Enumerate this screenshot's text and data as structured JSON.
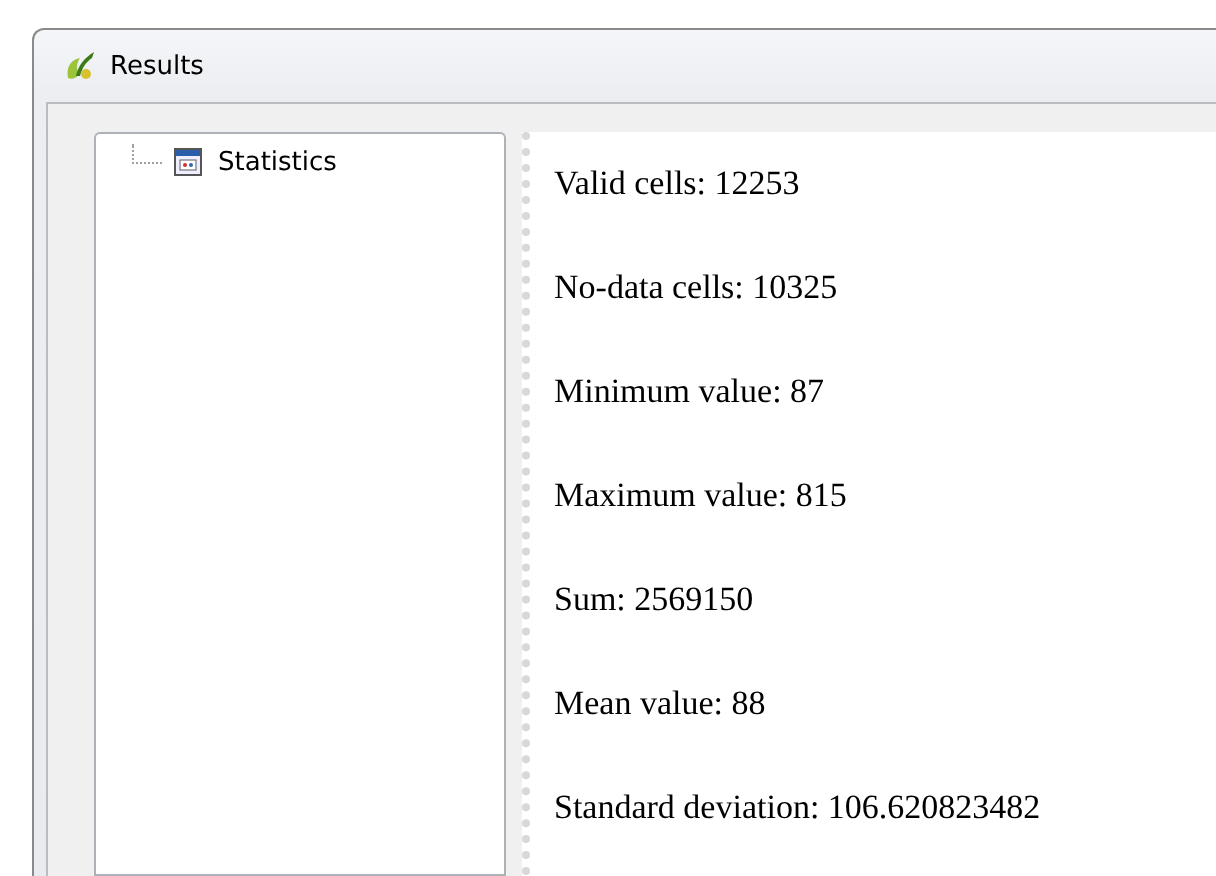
{
  "window": {
    "title": "Results"
  },
  "tree": {
    "items": [
      {
        "label": "Statistics",
        "selected": false
      }
    ]
  },
  "results": {
    "lines": [
      "Valid cells: 12253",
      "No-data cells: 10325",
      "Minimum value: 87",
      "Maximum value: 815",
      "Sum: 2569150",
      "Mean value: 88",
      "Standard deviation: 106.620823482"
    ]
  }
}
